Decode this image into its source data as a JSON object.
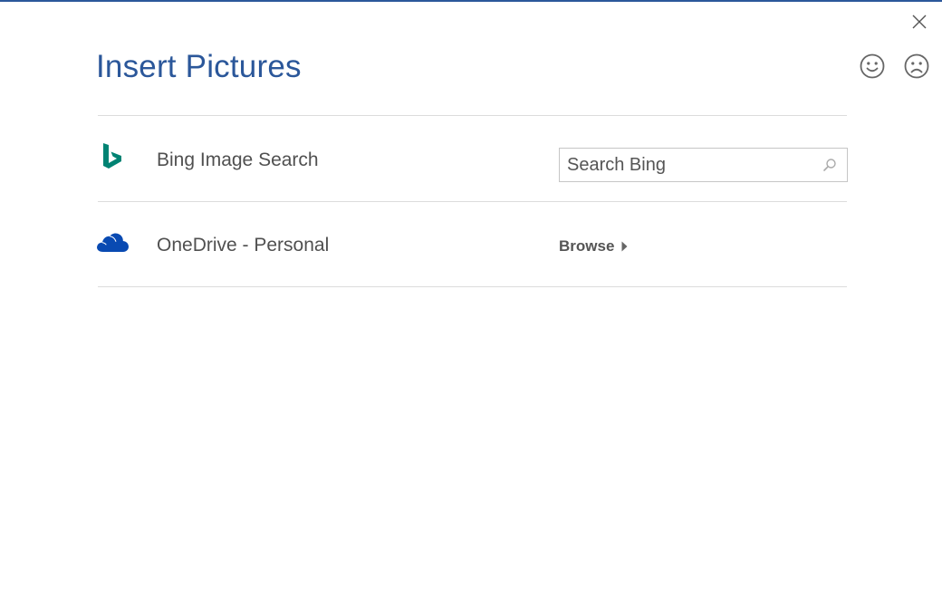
{
  "dialog": {
    "title": "Insert Pictures",
    "accent_color": "#2b579a"
  },
  "feedback": {
    "smile_icon": "smile-icon",
    "frown_icon": "frown-icon"
  },
  "close": {
    "icon": "close-icon"
  },
  "sources": [
    {
      "label": "Bing Image Search",
      "icon": "bing-logo-icon",
      "icon_color": "#008373",
      "search": {
        "placeholder": "Search Bing",
        "value": ""
      }
    },
    {
      "label": "OneDrive - Personal",
      "icon": "onedrive-cloud-icon",
      "icon_color": "#094ab2",
      "action_label": "Browse"
    }
  ]
}
